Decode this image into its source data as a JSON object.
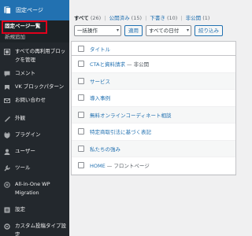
{
  "sidebar": {
    "header": {
      "label": "固定ページ",
      "icon": "pages-icon"
    },
    "submenu": [
      {
        "label": "固定ページ一覧",
        "current": true
      },
      {
        "label": "新規追加",
        "current": false
      }
    ],
    "items": [
      {
        "label": "すべての再利用ブロックを管理",
        "icon": "reusable-blocks-icon"
      },
      {
        "label": "コメント",
        "icon": "comments-icon"
      },
      {
        "label": "VK ブロックパターン",
        "icon": "vk-patterns-icon"
      },
      {
        "label": "お問い合わせ",
        "icon": "contact-icon"
      },
      {
        "label": "外観",
        "icon": "appearance-icon"
      },
      {
        "label": "プラグイン",
        "icon": "plugins-icon"
      },
      {
        "label": "ユーザー",
        "icon": "users-icon"
      },
      {
        "label": "ツール",
        "icon": "tools-icon"
      },
      {
        "label": "All-in-One WP Migration",
        "icon": "migration-icon"
      },
      {
        "label": "設定",
        "icon": "settings-icon"
      },
      {
        "label": "カスタム投稿タイプ設定",
        "icon": "custom-post-type-icon"
      }
    ],
    "colors": {
      "bg": "#23282d",
      "active": "#2271b1",
      "highlight": "#e0001b"
    }
  },
  "filters": {
    "all": "すべて",
    "all_count": "(26)",
    "published": "公開済み",
    "published_count": "(15)",
    "draft": "下書き",
    "draft_count": "(10)",
    "private": "非公開",
    "private_count": "(1)"
  },
  "toolbar": {
    "bulk": "一括操作",
    "apply": "適用",
    "date": "すべての日付",
    "filter": "絞り込み"
  },
  "table": {
    "column_title": "タイトル",
    "rows": [
      {
        "title": "CTAと資料請求",
        "state": " — 非公開"
      },
      {
        "title": "サービス",
        "state": ""
      },
      {
        "title": "導入事例",
        "state": ""
      },
      {
        "title": "無料オンラインコーディネート相談",
        "state": ""
      },
      {
        "title": "特定商取引法に基づく表記",
        "state": ""
      },
      {
        "title": "私たちの強み",
        "state": ""
      },
      {
        "title": "HOME",
        "state": " — フロントページ"
      }
    ]
  }
}
